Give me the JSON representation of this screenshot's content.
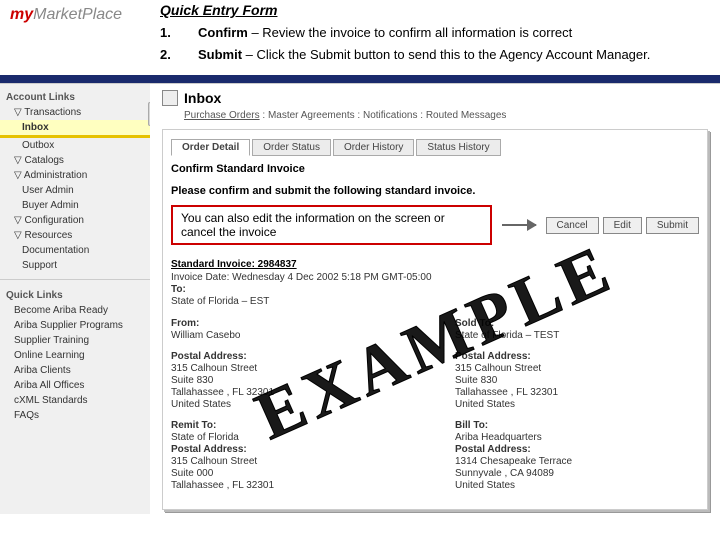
{
  "logo": {
    "prefix": "my",
    "brand": "MarketPlace"
  },
  "title": "Quick Entry Form",
  "steps": [
    {
      "num": "1.",
      "lead": "Confirm",
      "rest": " – Review the invoice to confirm all information is correct"
    },
    {
      "num": "2.",
      "lead": "Submit",
      "rest": " – Click the Submit button to send this to the Agency Account Manager."
    }
  ],
  "sidebar": {
    "group1_title": "Account Links",
    "transactions": "Transactions",
    "inbox": "Inbox",
    "outbox": "Outbox",
    "catalogs": "Catalogs",
    "administration": "Administration",
    "user_admin": "User Admin",
    "buyer_admin": "Buyer Admin",
    "configuration": "Configuration",
    "resources": "Resources",
    "documentation": "Documentation",
    "support": "Support",
    "quick_title": "Quick Links",
    "ql": [
      "Become Ariba Ready",
      "Ariba Supplier Programs",
      "Supplier Training",
      "Online Learning",
      "Ariba Clients",
      "Ariba All Offices",
      "cXML Standards",
      "FAQs"
    ]
  },
  "inbox_title": "Inbox",
  "breadcrumb": [
    "Purchase Orders",
    "Master Agreements",
    "Notifications",
    "Routed Messages"
  ],
  "tabs": [
    "Order Detail",
    "Order Status",
    "Order History",
    "Status History"
  ],
  "panel_title": "Confirm Standard Invoice",
  "instruction": "Please confirm and submit the following standard invoice.",
  "edit_note": "You can also edit the information on the screen or cancel the invoice",
  "buttons": {
    "cancel": "Cancel",
    "edit": "Edit",
    "submit": "Submit"
  },
  "details": {
    "std_heading": "Standard Invoice: 2984837",
    "inv_date": "Invoice Date: Wednesday 4 Dec 2002 5:18 PM GMT-05:00",
    "to_label": "To:",
    "to_line": "State of Florida – EST",
    "from_label": "From:",
    "from_name": "William Casebo",
    "postal_label": "Postal Address:",
    "addr1": "315 Calhoun Street",
    "addr2": "Suite 830",
    "addr3": "Tallahassee , FL 32301",
    "addr4": "United States",
    "sold_label": "Sold To:",
    "sold_name": "State of Florida – TEST",
    "remit_label": "Remit To:",
    "remit_name": "State of Florida",
    "remit_addr1": "315 Calhoun Street",
    "remit_addr2": "Suite 000",
    "remit_addr3": "Tallahassee , FL 32301",
    "bill_label": "Bill To:",
    "bill_name": "Ariba Headquarters",
    "bill_addr1": "1314 Chesapeake Terrace",
    "bill_addr2": "Sunnyvale , CA 94089",
    "bill_addr3": "United States"
  },
  "watermark": "EXAMPLE"
}
